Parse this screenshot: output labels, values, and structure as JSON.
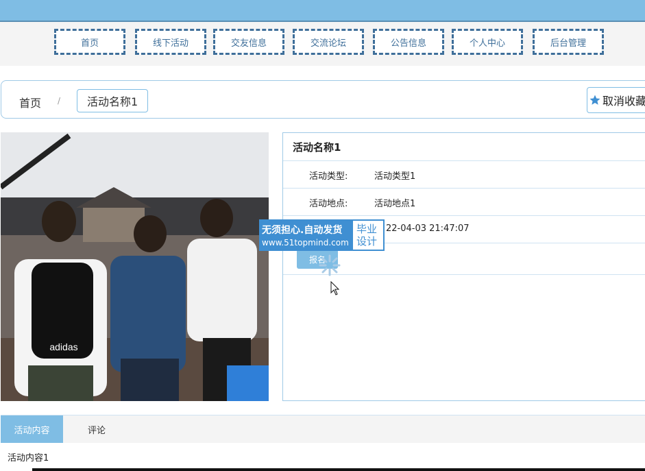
{
  "nav": {
    "items": [
      {
        "label": "首页"
      },
      {
        "label": "线下活动"
      },
      {
        "label": "交友信息"
      },
      {
        "label": "交流论坛"
      },
      {
        "label": "公告信息"
      },
      {
        "label": "个人中心"
      },
      {
        "label": "后台管理"
      }
    ]
  },
  "breadcrumb": {
    "home": "首页",
    "separator": "/",
    "current": "活动名称1"
  },
  "favorite": {
    "label": "取消收藏"
  },
  "detail": {
    "title": "活动名称1",
    "rows": [
      {
        "label": "活动类型:",
        "value": "活动类型1"
      },
      {
        "label": "活动地点:",
        "value": "活动地点1"
      },
      {
        "label": "",
        "value": "22-04-03 21:47:07"
      }
    ],
    "signup_label": "报名"
  },
  "watermark": {
    "line1": "无须担心.自动发货",
    "line2": "www.51topmind.com",
    "right1": "毕业",
    "right2": "设计"
  },
  "photo_logo": "adidas",
  "tabs": {
    "items": [
      {
        "label": "活动内容"
      },
      {
        "label": "评论"
      }
    ]
  },
  "content": {
    "text": "活动内容1"
  },
  "colors": {
    "primary": "#7fbde4",
    "nav_border": "#3f6f9a",
    "watermark_blue": "#3f8fd2"
  }
}
